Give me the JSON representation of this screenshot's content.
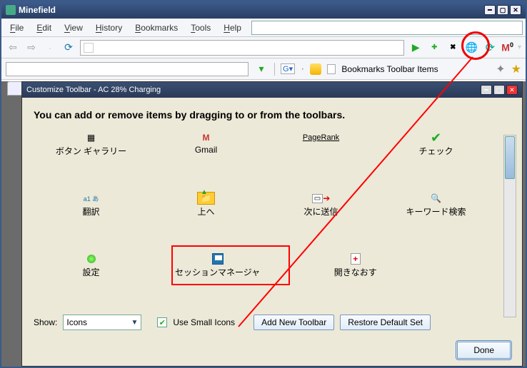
{
  "app": {
    "title": "Minefield"
  },
  "menubar": [
    "File",
    "Edit",
    "View",
    "History",
    "Bookmarks",
    "Tools",
    "Help"
  ],
  "navbar": {
    "gmail_count": "0"
  },
  "bookbar": {
    "g_label": "G",
    "bookmarks_label": "Bookmarks Toolbar Items"
  },
  "dialog": {
    "title": "Customize Toolbar  - AC 28% Charging",
    "heading": "You can add or remove items by dragging to or from the toolbars.",
    "items_row1": [
      {
        "label": "ボタン ギャラリー"
      },
      {
        "label": "Gmail"
      },
      {
        "label": "PageRank"
      },
      {
        "label": "チェック"
      }
    ],
    "items_row2": [
      {
        "label": "翻訳"
      },
      {
        "label": "上へ"
      },
      {
        "label": "次に送信"
      },
      {
        "label": "キーワード検索"
      }
    ],
    "items_row3": [
      {
        "label": "設定"
      },
      {
        "label": "セッションマネージャ"
      },
      {
        "label": "開きなおす"
      }
    ],
    "show_label": "Show:",
    "show_value": "Icons",
    "small_icons_label": "Use Small Icons",
    "small_icons_checked": true,
    "add_toolbar_label": "Add New Toolbar",
    "restore_label": "Restore Default Set",
    "done_label": "Done"
  },
  "row2_sub": "a1? a\n翻訳"
}
